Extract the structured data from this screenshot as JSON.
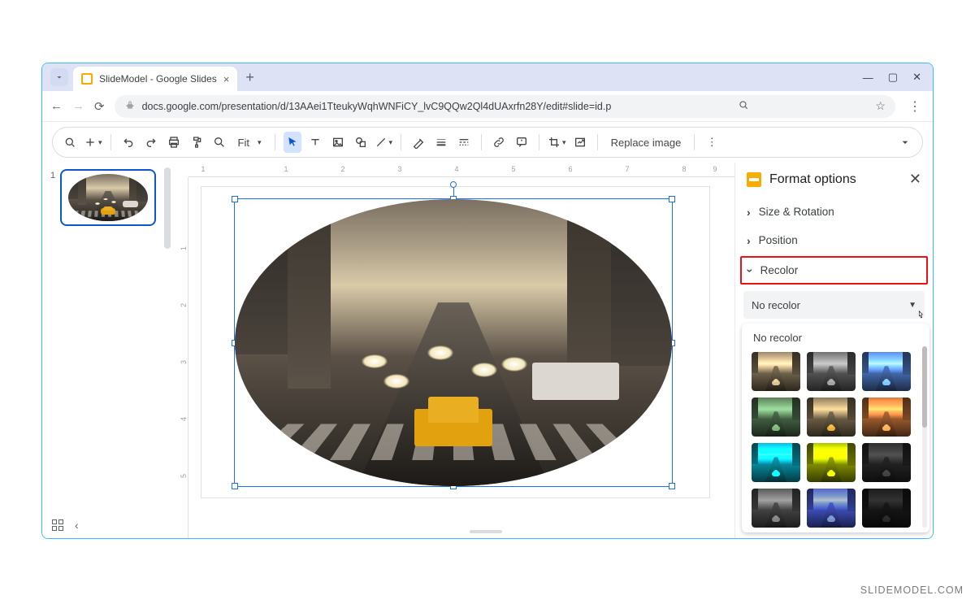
{
  "browser": {
    "tab_title": "SlideModel - Google Slides",
    "url": "docs.google.com/presentation/d/13AAei1TteukyWqhWNFiCY_lvC9QQw2Ql4dUAxrfn28Y/edit#slide=id.p"
  },
  "toolbar": {
    "zoom_label": "Fit",
    "replace_image_label": "Replace image"
  },
  "ruler": {
    "h": [
      "1",
      "",
      "1",
      "2",
      "3",
      "4",
      "5",
      "6",
      "7",
      "8",
      "9"
    ],
    "v": [
      "",
      "1",
      "2",
      "3",
      "4",
      "5"
    ]
  },
  "slides": {
    "items": [
      {
        "number": "1"
      }
    ]
  },
  "format_panel": {
    "title": "Format options",
    "sections": {
      "size_rotation": "Size & Rotation",
      "position": "Position",
      "recolor": "Recolor"
    },
    "recolor_dropdown": {
      "selected": "No recolor",
      "popup_label": "No recolor"
    }
  },
  "watermark": "SLIDEMODEL.COM"
}
